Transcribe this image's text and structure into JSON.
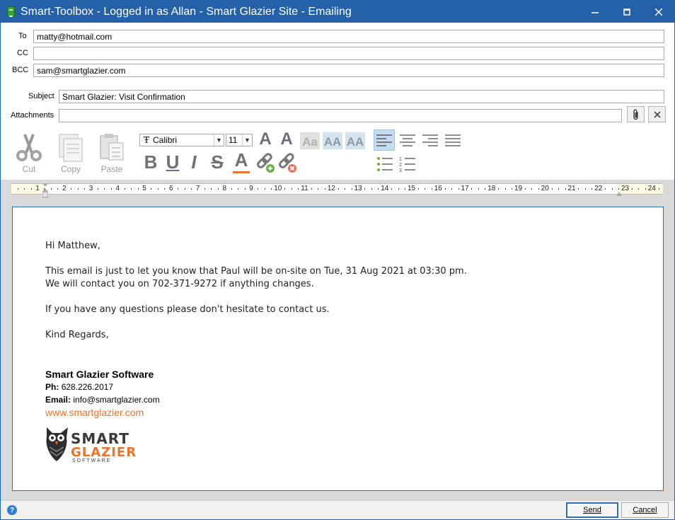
{
  "window": {
    "title": "Smart-Toolbox - Logged in as Allan - Smart Glazier Site - Emailing",
    "minimize_icon": "minimize-icon",
    "maximize_icon": "maximize-icon",
    "close_icon": "close-icon"
  },
  "header": {
    "to_label": "To",
    "to_value": "matty@hotmail.com",
    "cc_label": "CC",
    "cc_value": "",
    "bcc_label": "BCC",
    "bcc_value": "sam@smartglazier.com",
    "subject_label": "Subject",
    "subject_value": "Smart Glazier: Visit Confirmation",
    "attachments_label": "Attachments",
    "attachments_value": ""
  },
  "toolbar": {
    "cut_label": "Cut",
    "copy_label": "Copy",
    "paste_label": "Paste",
    "font_family": "Calibri",
    "font_size": "11",
    "bold": "B",
    "underline": "U",
    "italic": "I",
    "strike": "S",
    "color": "A"
  },
  "ruler": {
    "numbers": [
      "1",
      "2",
      "3",
      "4",
      "5",
      "6",
      "7",
      "8",
      "9",
      "10",
      "11",
      "12",
      "13",
      "14",
      "15",
      "16",
      "17",
      "18",
      "19",
      "20",
      "21",
      "22",
      "23",
      "24"
    ]
  },
  "email": {
    "greeting": "Hi Matthew,",
    "line1": "This email is just to let you know that Paul will be on-site on Tue, 31 Aug 2021 at 03:30 pm.",
    "line2": "We will contact you on 702-371-9272 if anything changes.",
    "line3": "If you have any questions please don't hesitate to contact us.",
    "closing": "Kind Regards,",
    "sig_name": "Smart Glazier Software",
    "ph_label": "Ph:",
    "ph_value": "628.226.2017",
    "email_label": "Email:",
    "email_value": "info@smartglazier.com",
    "website": "www.smartglazier.com",
    "logo_line1": "SMART",
    "logo_line2": "GLAZIER",
    "logo_line3": "SOFTWARE"
  },
  "footer": {
    "send_label": "Send",
    "cancel_label": "Cancel",
    "help_icon": "help-icon"
  },
  "colors": {
    "titlebar": "#2561a9",
    "accent": "#e8752b"
  }
}
